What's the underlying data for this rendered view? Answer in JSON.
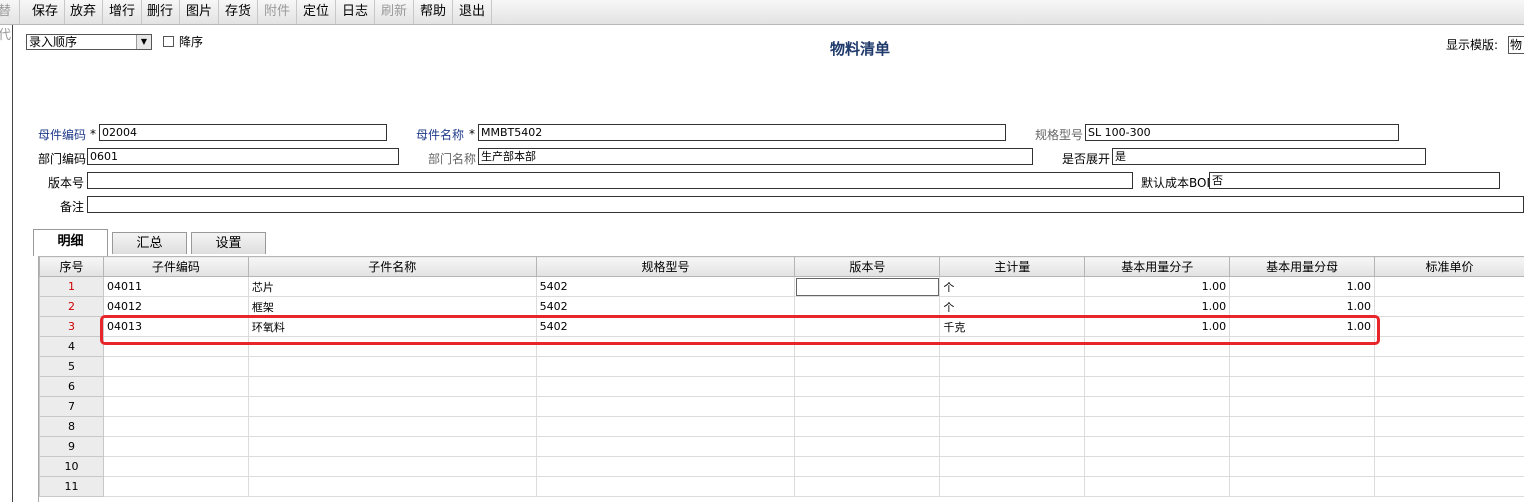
{
  "toolbar": {
    "items": [
      {
        "label": "替代",
        "disabled": true
      },
      {
        "label": "保存",
        "disabled": false
      },
      {
        "label": "放弃",
        "disabled": false
      },
      {
        "label": "增行",
        "disabled": false
      },
      {
        "label": "删行",
        "disabled": false
      },
      {
        "label": "图片",
        "disabled": false
      },
      {
        "label": "存货",
        "disabled": false
      },
      {
        "label": "附件",
        "disabled": true
      },
      {
        "label": "定位",
        "disabled": false
      },
      {
        "label": "日志",
        "disabled": false
      },
      {
        "label": "刷新",
        "disabled": true
      },
      {
        "label": "帮助",
        "disabled": false
      },
      {
        "label": "退出",
        "disabled": false
      }
    ]
  },
  "sort": {
    "selected": "录入顺序",
    "descending_label": "降序",
    "descending_checked": false
  },
  "page_title": "物料清单",
  "template": {
    "label": "显示模版:",
    "value": "物"
  },
  "form": {
    "parent_code": {
      "label": "母件编码",
      "required": "*",
      "value": "02004"
    },
    "parent_name": {
      "label": "母件名称",
      "required": "*",
      "value": "MMBT5402"
    },
    "spec": {
      "label": "规格型号",
      "value": "SL 100-300"
    },
    "dept_code": {
      "label": "部门编码",
      "value": "0601"
    },
    "dept_name": {
      "label": "部门名称",
      "value": "生产部本部"
    },
    "expand": {
      "label": "是否展开",
      "value": "是"
    },
    "version": {
      "label": "版本号",
      "value": ""
    },
    "default_cost_bom": {
      "label": "默认成本BOM",
      "value": "否"
    },
    "remark": {
      "label": "备注",
      "value": ""
    }
  },
  "tabs": [
    {
      "label": "明细",
      "active": true
    },
    {
      "label": "汇总",
      "active": false
    },
    {
      "label": "设置",
      "active": false
    }
  ],
  "grid": {
    "columns": [
      "序号",
      "子件编码",
      "子件名称",
      "规格型号",
      "版本号",
      "主计量",
      "基本用量分子",
      "基本用量分母",
      "标准单价"
    ],
    "rows": [
      {
        "no": "1",
        "code": "04011",
        "name": "芯片",
        "spec": "5402",
        "version": "",
        "uom": "个",
        "num": "1.00",
        "den": "1.00",
        "price": ""
      },
      {
        "no": "2",
        "code": "04012",
        "name": "框架",
        "spec": "5402",
        "version": "",
        "uom": "个",
        "num": "1.00",
        "den": "1.00",
        "price": ""
      },
      {
        "no": "3",
        "code": "04013",
        "name": "环氧料",
        "spec": "5402",
        "version": "",
        "uom": "千克",
        "num": "1.00",
        "den": "1.00",
        "price": ""
      },
      {
        "no": "4",
        "code": "",
        "name": "",
        "spec": "",
        "version": "",
        "uom": "",
        "num": "",
        "den": "",
        "price": ""
      },
      {
        "no": "5",
        "code": "",
        "name": "",
        "spec": "",
        "version": "",
        "uom": "",
        "num": "",
        "den": "",
        "price": ""
      },
      {
        "no": "6",
        "code": "",
        "name": "",
        "spec": "",
        "version": "",
        "uom": "",
        "num": "",
        "den": "",
        "price": ""
      },
      {
        "no": "7",
        "code": "",
        "name": "",
        "spec": "",
        "version": "",
        "uom": "",
        "num": "",
        "den": "",
        "price": ""
      },
      {
        "no": "8",
        "code": "",
        "name": "",
        "spec": "",
        "version": "",
        "uom": "",
        "num": "",
        "den": "",
        "price": ""
      },
      {
        "no": "9",
        "code": "",
        "name": "",
        "spec": "",
        "version": "",
        "uom": "",
        "num": "",
        "den": "",
        "price": ""
      },
      {
        "no": "10",
        "code": "",
        "name": "",
        "spec": "",
        "version": "",
        "uom": "",
        "num": "",
        "den": "",
        "price": ""
      },
      {
        "no": "11",
        "code": "",
        "name": "",
        "spec": "",
        "version": "",
        "uom": "",
        "num": "",
        "den": "",
        "price": ""
      }
    ]
  },
  "colors": {
    "title": "#1f3a6b",
    "label_blue": "#1f3a8a",
    "row_number_red": "#d00000",
    "highlight": "#e8252b"
  }
}
